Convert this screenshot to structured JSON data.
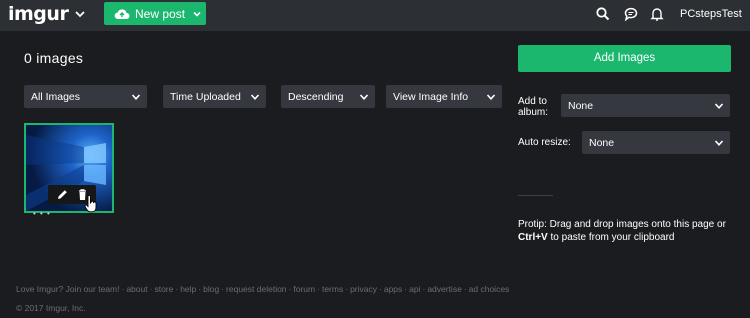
{
  "header": {
    "logo": "imgur",
    "new_post_label": "New post",
    "username": "PCstepsTest",
    "icons": [
      "search-icon",
      "chat-icon",
      "bell-icon"
    ]
  },
  "main": {
    "image_count": "0 images",
    "filters": [
      {
        "label": "All Images"
      },
      {
        "label": "Time Uploaded"
      },
      {
        "label": "Descending"
      },
      {
        "label": "View Image Info"
      }
    ],
    "thumbnail": {
      "tools": [
        "pencil-icon",
        "trash-icon"
      ],
      "dots": "• • •"
    }
  },
  "sidebar": {
    "add_images_label": "Add Images",
    "add_to_album_label": "Add to album:",
    "add_to_album_value": "None",
    "auto_resize_label": "Auto resize:",
    "auto_resize_value": "None",
    "protip_prefix": "Protip: Drag and drop images onto this page or",
    "protip_key": "Ctrl+V",
    "protip_suffix": "to paste from your clipboard"
  },
  "footer": {
    "links": [
      "Love Imgur? Join our team!",
      "about",
      "store",
      "help",
      "blog",
      "request deletion",
      "forum",
      "terms",
      "privacy",
      "apps",
      "api",
      "advertise",
      "ad choices"
    ],
    "copyright": "© 2017 Imgur, Inc."
  },
  "colors": {
    "accent": "#1bb76e",
    "background": "#1b1c1f",
    "header": "#2c2f34",
    "control": "#35383e"
  }
}
